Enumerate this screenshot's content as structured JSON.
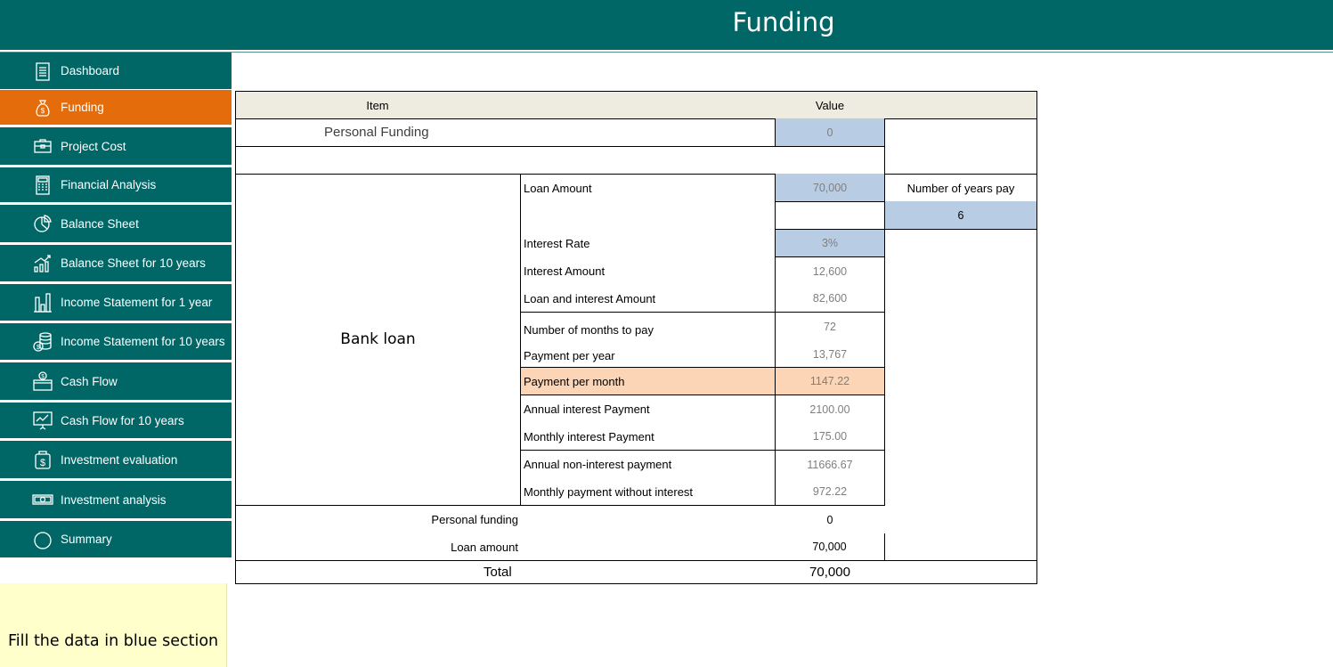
{
  "header": {
    "title": "Funding"
  },
  "sidebar": {
    "items": [
      {
        "label": "Dashboard",
        "icon": "dashboard-icon"
      },
      {
        "label": "Funding",
        "icon": "money-bag-icon",
        "active": true
      },
      {
        "label": "Project Cost",
        "icon": "briefcase-icon"
      },
      {
        "label": "Financial Analysis",
        "icon": "calculator-icon"
      },
      {
        "label": "Balance Sheet",
        "icon": "pie-chart-icon"
      },
      {
        "label": "Balance Sheet for 10 years",
        "icon": "growth-bars-icon"
      },
      {
        "label": "Income Statement for 1 year",
        "icon": "bar-chart-icon"
      },
      {
        "label": "Income Statement for 10 years",
        "icon": "coins-stack-icon"
      },
      {
        "label": "Cash Flow",
        "icon": "wallet-icon"
      },
      {
        "label": "Cash Flow for 10 years",
        "icon": "presentation-chart-icon"
      },
      {
        "label": "Investment evaluation",
        "icon": "dollar-jar-icon"
      },
      {
        "label": "Investment analysis",
        "icon": "banknote-icon"
      },
      {
        "label": "Summary",
        "icon": "circle-icon"
      }
    ]
  },
  "note": {
    "text": "Fill the data in blue section"
  },
  "table": {
    "header_item": "Item",
    "header_value": "Value",
    "personal_funding_label": "Personal Funding",
    "personal_funding_value": "0",
    "bank_loan_label": "Bank loan",
    "loan_amount_label": "Loan Amount",
    "loan_amount_value": "70,000",
    "years_label": "Number of years pay",
    "years_value": "6",
    "interest_rate_label": "Interest Rate",
    "interest_rate_value": "3%",
    "interest_amount_label": "Interest Amount",
    "interest_amount_value": "12,600",
    "loan_interest_label": "Loan and interest Amount",
    "loan_interest_value": "82,600",
    "months_label": "Number of months to pay",
    "months_value": "72",
    "payment_year_label": "Payment per year",
    "payment_year_value": "13,767",
    "payment_month_label": "Payment per month",
    "payment_month_value": "1147.22",
    "annual_interest_label": "Annual interest Payment",
    "annual_interest_value": "2100.00",
    "monthly_interest_label": "Monthly interest Payment",
    "monthly_interest_value": "175.00",
    "annual_noninterest_label": "Annual non-interest payment",
    "annual_noninterest_value": "11666.67",
    "monthly_nointerest_label": "Monthly payment without interest",
    "monthly_nointerest_value": "972.22",
    "summary_personal_label": "Personal funding",
    "summary_personal_value": "0",
    "summary_loan_label": "Loan amount",
    "summary_loan_value": "70,000",
    "total_label": "Total",
    "total_value": "70,000"
  }
}
